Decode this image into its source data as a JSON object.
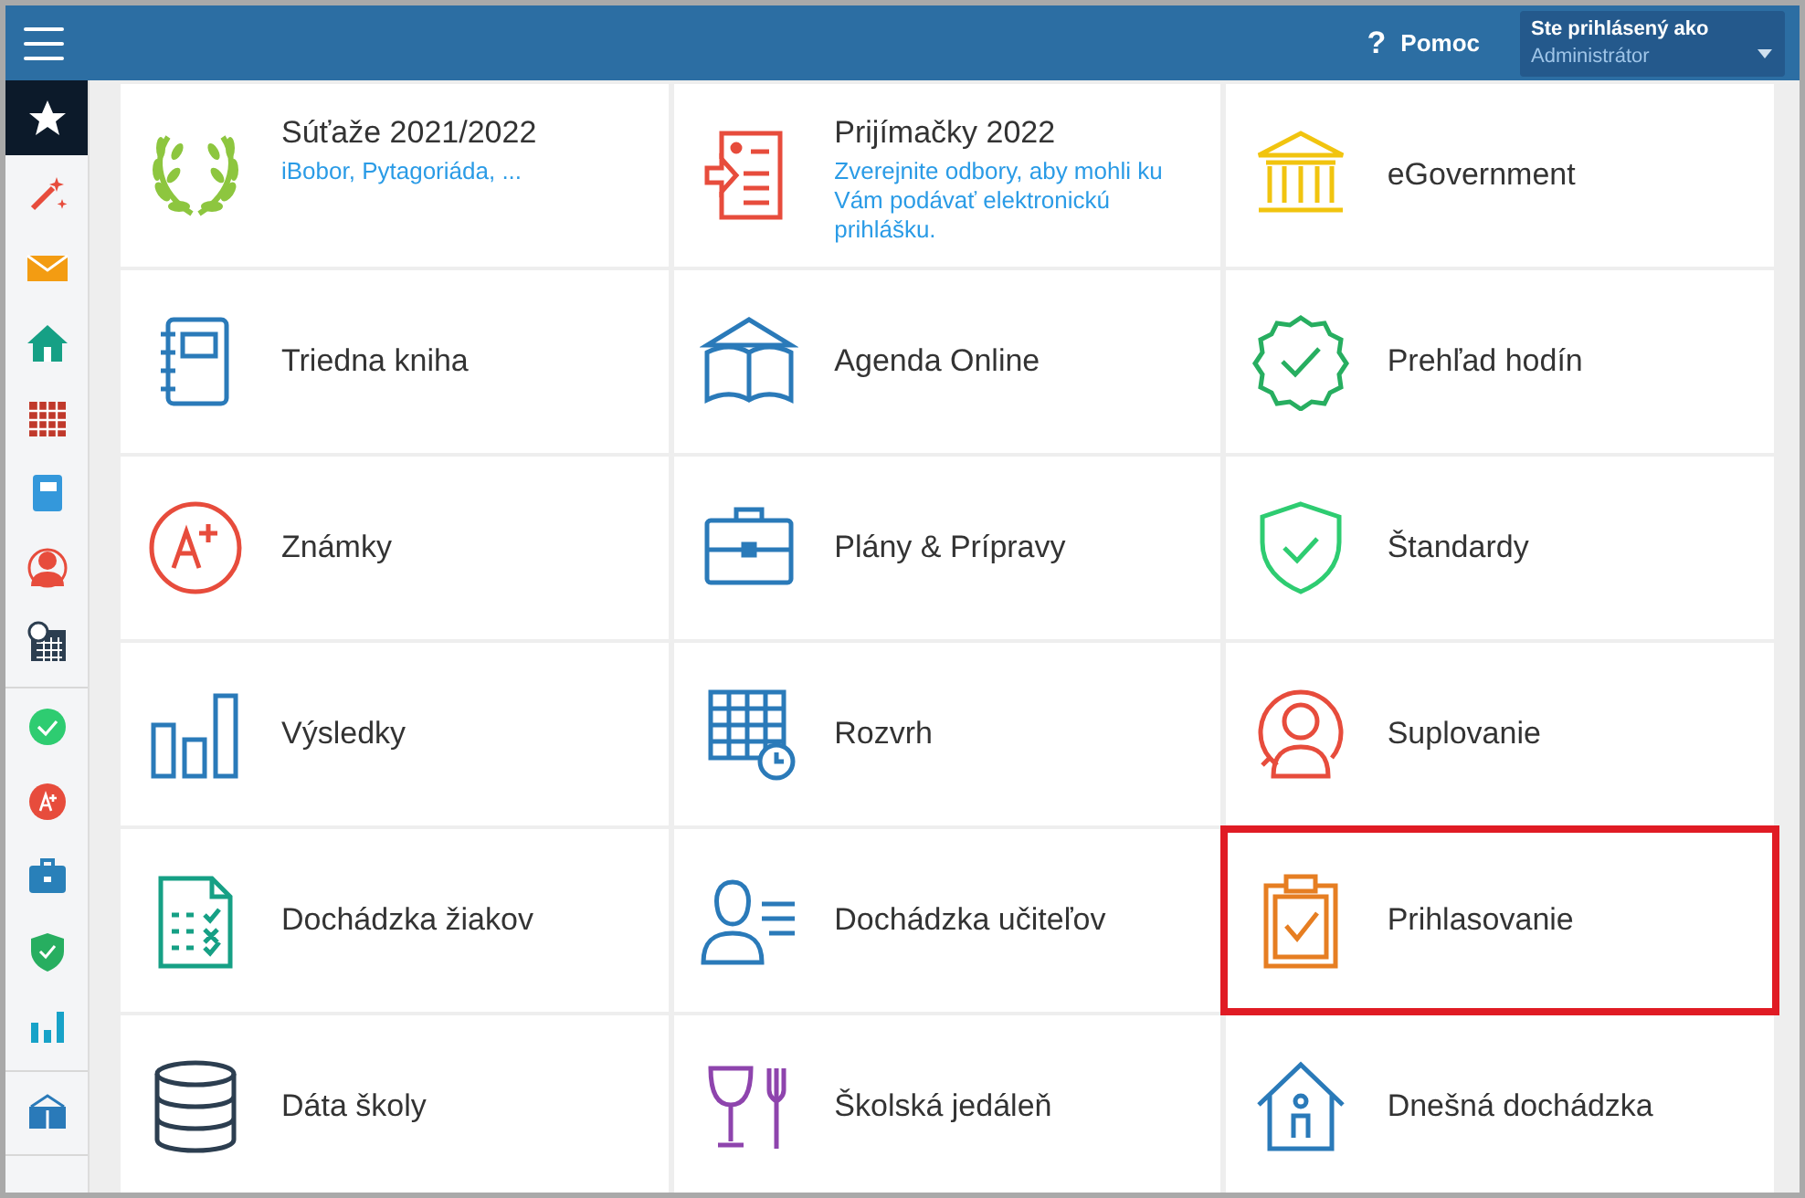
{
  "header": {
    "help": {
      "icon": "?",
      "label": "Pomoc"
    },
    "user": {
      "caption": "Ste prihlásený ako",
      "role": "Administrátor"
    }
  },
  "sidebar": {
    "groups": [
      [
        {
          "selected": true
        },
        {
          "selected": false
        },
        {
          "selected": false
        },
        {
          "selected": false
        },
        {
          "selected": false
        },
        {
          "selected": false
        },
        {
          "selected": false
        },
        {
          "selected": false
        }
      ],
      [
        {
          "selected": false
        },
        {
          "selected": false
        },
        {
          "selected": false
        },
        {
          "selected": false
        },
        {
          "selected": false
        }
      ],
      [
        {
          "selected": false
        }
      ]
    ]
  },
  "tiles": [
    {
      "title": "Súťaže 2021/2022",
      "subtitle": "iBobor, Pytagoriáda, ...",
      "highlighted": false
    },
    {
      "title": "Prijímačky 2022",
      "subtitle": "Zverejnite odbory, aby mohli ku Vám podávať elektronickú prihlášku.",
      "highlighted": false
    },
    {
      "title": "eGovernment",
      "highlighted": false
    },
    {
      "title": "Triedna kniha",
      "highlighted": false
    },
    {
      "title": "Agenda Online",
      "highlighted": false
    },
    {
      "title": "Prehľad hodín",
      "highlighted": false
    },
    {
      "title": "Známky",
      "highlighted": false
    },
    {
      "title": "Plány & Prípravy",
      "highlighted": false
    },
    {
      "title": "Štandardy",
      "highlighted": false
    },
    {
      "title": "Výsledky",
      "highlighted": false
    },
    {
      "title": "Rozvrh",
      "highlighted": false
    },
    {
      "title": "Suplovanie",
      "highlighted": false
    },
    {
      "title": "Dochádzka žiakov",
      "highlighted": false
    },
    {
      "title": "Dochádzka učiteľov",
      "highlighted": false
    },
    {
      "title": "Prihlasovanie",
      "highlighted": true
    },
    {
      "title": "Dáta školy",
      "highlighted": false
    },
    {
      "title": "Školská jedáleň",
      "highlighted": false
    },
    {
      "title": "Dnešná dochádzka",
      "highlighted": false
    }
  ]
}
